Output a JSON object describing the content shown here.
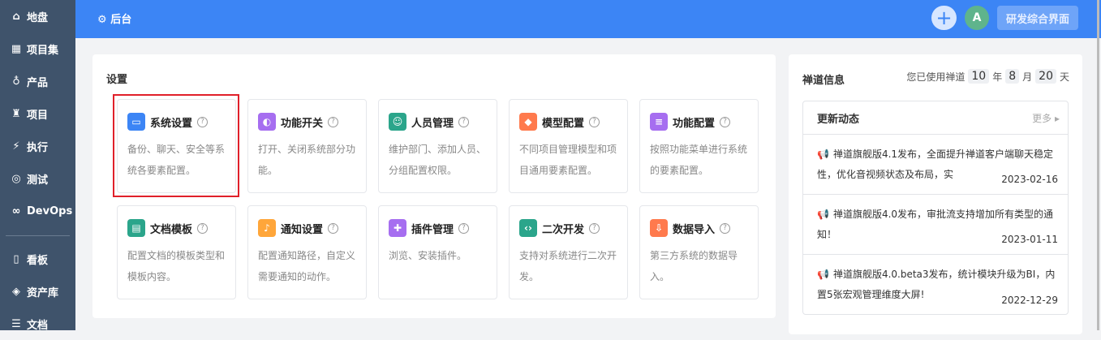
{
  "sidebar": {
    "items": [
      {
        "icon": "home-icon",
        "glyph": "⌂",
        "label": "地盘"
      },
      {
        "icon": "grid-icon",
        "glyph": "▦",
        "label": "项目集"
      },
      {
        "icon": "bulb-icon",
        "glyph": "♁",
        "label": "产品"
      },
      {
        "icon": "rocket-icon",
        "glyph": "♜",
        "label": "项目"
      },
      {
        "icon": "run-icon",
        "glyph": "⚡",
        "label": "执行"
      },
      {
        "icon": "search-icon",
        "glyph": "◎",
        "label": "测试"
      },
      {
        "icon": "infinity-icon",
        "glyph": "∞",
        "label": "DevOps"
      }
    ],
    "items2": [
      {
        "icon": "board-icon",
        "glyph": "▯",
        "label": "看板"
      },
      {
        "icon": "diamond-icon",
        "glyph": "◈",
        "label": "资产库"
      },
      {
        "icon": "doc-icon",
        "glyph": "☰",
        "label": "文档"
      }
    ]
  },
  "header": {
    "title": "后台",
    "avatar": "A",
    "mode": "研发综合界面"
  },
  "settings": {
    "title": "设置",
    "cards": [
      {
        "name": "系统设置",
        "desc": "备份、聊天、安全等系统各要素配置。",
        "color": "#3c85f5",
        "glyph": "▭"
      },
      {
        "name": "功能开关",
        "desc": "打开、关闭系统部分功能。",
        "color": "#a66ef0",
        "glyph": "◐"
      },
      {
        "name": "人员管理",
        "desc": "维护部门、添加人员、分组配置权限。",
        "color": "#2ba58b",
        "glyph": "☺"
      },
      {
        "name": "模型配置",
        "desc": "不同项目管理模型和项目通用要素配置。",
        "color": "#ff7a4d",
        "glyph": "◆"
      },
      {
        "name": "功能配置",
        "desc": "按照功能菜单进行系统的要素配置。",
        "color": "#a66ef0",
        "glyph": "≡"
      },
      {
        "name": "文档模板",
        "desc": "配置文档的模板类型和模板内容。",
        "color": "#2ba58b",
        "glyph": "▤"
      },
      {
        "name": "通知设置",
        "desc": "配置通知路径，自定义需要通知的动作。",
        "color": "#ffa63a",
        "glyph": "♪"
      },
      {
        "name": "插件管理",
        "desc": "浏览、安装插件。",
        "color": "#a66ef0",
        "glyph": "✚"
      },
      {
        "name": "二次开发",
        "desc": "支持对系统进行二次开发。",
        "color": "#2ba58b",
        "glyph": "‹›"
      },
      {
        "name": "数据导入",
        "desc": "第三方系统的数据导入。",
        "color": "#ff7a4d",
        "glyph": "⇩"
      }
    ]
  },
  "info": {
    "title": "禅道信息",
    "used_prefix": "您已使用禅道",
    "years": "10",
    "year_unit": "年",
    "months": "8",
    "month_unit": "月",
    "days": "20",
    "day_unit": "天",
    "news": {
      "title": "更新动态",
      "more": "更多",
      "items": [
        {
          "text": "禅道旗舰版4.1发布，全面提升禅道客户端聊天稳定性，优化音视频状态及布局，实",
          "date": "2023-02-16"
        },
        {
          "text": "禅道旗舰版4.0发布，审批流支持增加所有类型的通知！",
          "date": "2023-01-11"
        },
        {
          "text": "禅道旗舰版4.0.beta3发布，统计模块升级为BI，内置5张宏观管理维度大屏!",
          "date": "2022-12-29"
        }
      ]
    }
  }
}
